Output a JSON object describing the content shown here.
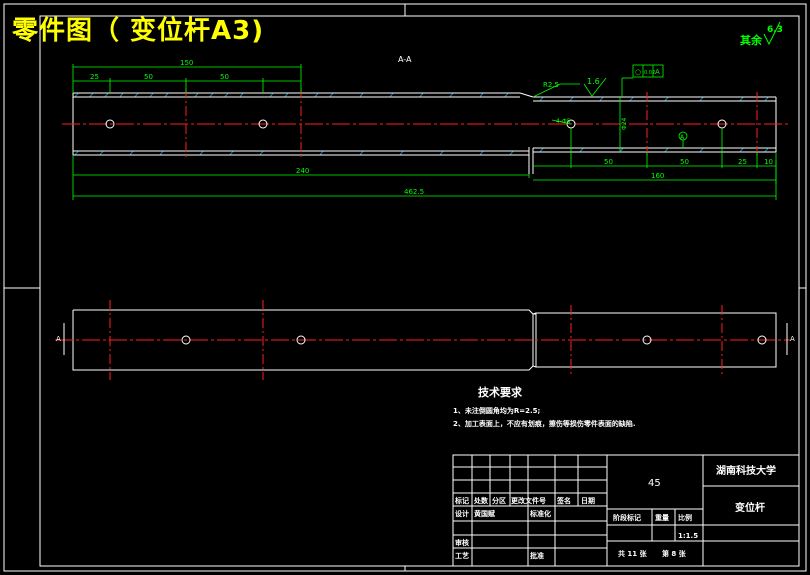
{
  "title": "零件图（ 变位杆A3)",
  "roughness": {
    "label": "其余",
    "value": "6.3"
  },
  "section_label": "A-A",
  "dims_top": {
    "d25": "25",
    "d50a": "50",
    "d50b": "50",
    "d150": "150"
  },
  "dims_bottom": {
    "d240": "240",
    "total": "462.5"
  },
  "chamfer": "R2.5",
  "roughness_small": "1.6",
  "hole_dim": "4-Φ5",
  "diameter": "Φ24",
  "tolerance": {
    "c1": "○",
    "c2": "0.02",
    "c3": "A"
  },
  "dims_right": {
    "d50a": "50",
    "d50b": "50",
    "d25": "25",
    "d10": "10",
    "d160": "160"
  },
  "datum_marker": "A",
  "section_marks": {
    "left": "A",
    "right": "A"
  },
  "tech_req": {
    "heading": "技术要求",
    "line1": "1、未注倒圆角均为R=2.5;",
    "line2": "2、加工表面上，不应有划痕，擦伤等损伤零件表面的缺陷."
  },
  "title_block": {
    "material": "45",
    "school": "湖南科技大学",
    "part_name": "变位杆",
    "headers": [
      "标记",
      "处数",
      "分区",
      "更改文件号",
      "签名",
      "日期"
    ],
    "designer": "设计",
    "designer_name": "黄国赋",
    "standard": "标准化",
    "stage_mark": "阶段标记",
    "weight": "重量",
    "scale_label": "比例",
    "scale": "1:1.5",
    "review": "审核",
    "process": "工艺",
    "approve": "批准",
    "sheets_total": "共 11 张",
    "sheet_no": "第 8 张"
  }
}
